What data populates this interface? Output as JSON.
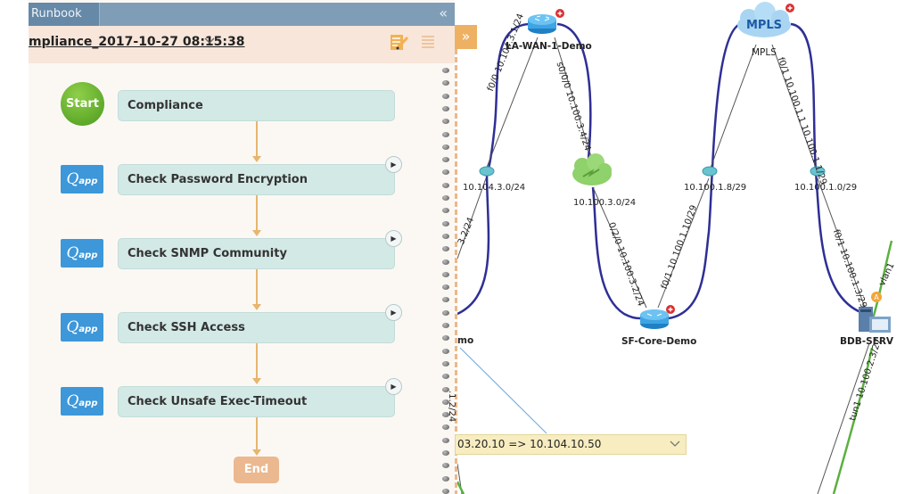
{
  "runbook_panel": {
    "tab_label": "Runbook",
    "collapse_icon": "double-chevron-left",
    "run_title": "mpliance_2017-10-27 08:15:38 ",
    "run_title_chevron": "⌄",
    "toolbar": {
      "note_icon": "notepad-edit-icon",
      "menu_icon": "list-menu-icon"
    },
    "expand_icon": "»",
    "flow": {
      "start": {
        "label": "Start",
        "node_label": "Compliance"
      },
      "steps": [
        {
          "badge": "Q",
          "badge_sub": "app",
          "label": "Check Password Encryption"
        },
        {
          "badge": "Q",
          "badge_sub": "app",
          "label": "Check SNMP Community"
        },
        {
          "badge": "Q",
          "badge_sub": "app",
          "label": "Check SSH Access"
        },
        {
          "badge": "Q",
          "badge_sub": "app",
          "label": "Check Unsafe Exec-Timeout"
        }
      ],
      "end": {
        "label": "End"
      },
      "play_glyph": "▶"
    }
  },
  "map": {
    "devices": [
      {
        "name": "LA-WAN-1-Demo",
        "type": "router"
      },
      {
        "name": "MPLS",
        "type": "mpls-cloud",
        "cloud_text": "MPLS"
      },
      {
        "name": "SF-Core-Demo",
        "type": "router"
      },
      {
        "name": "BDB-SERV",
        "type": "server"
      },
      {
        "name": "mo",
        "type": "router"
      }
    ],
    "subnets": [
      "10.104.3.0/24",
      "10.100.3.0/24",
      "10.100.1.8/29",
      "10.100.1.0/29"
    ],
    "links": [
      "f0/0 10.104.3.1/24",
      "s0/0/0 10.100.3.4/24",
      "f0/1 10.100.1.1 10.100.1.1/29",
      "0/2/0 10.100.3.2/24",
      "f0/1 10.100.1.10/29",
      "f0/1 10.100.1.3/29",
      "vlan1",
      "tun1 10.100.2.3/27",
      "3.2/24",
      ".1.2/24"
    ],
    "path_selector": {
      "value": "03.20.10 => 10.104.10.50",
      "chevron": "⌄"
    }
  },
  "colors": {
    "tab_bar": "#7f9db6",
    "header_bg": "#f8e6da",
    "node_bg": "#d3e9e6",
    "qapp_blue": "#3d97d9",
    "connector": "#e6b56e",
    "link_blue": "#2e2f95",
    "link_green": "#5cb040"
  }
}
